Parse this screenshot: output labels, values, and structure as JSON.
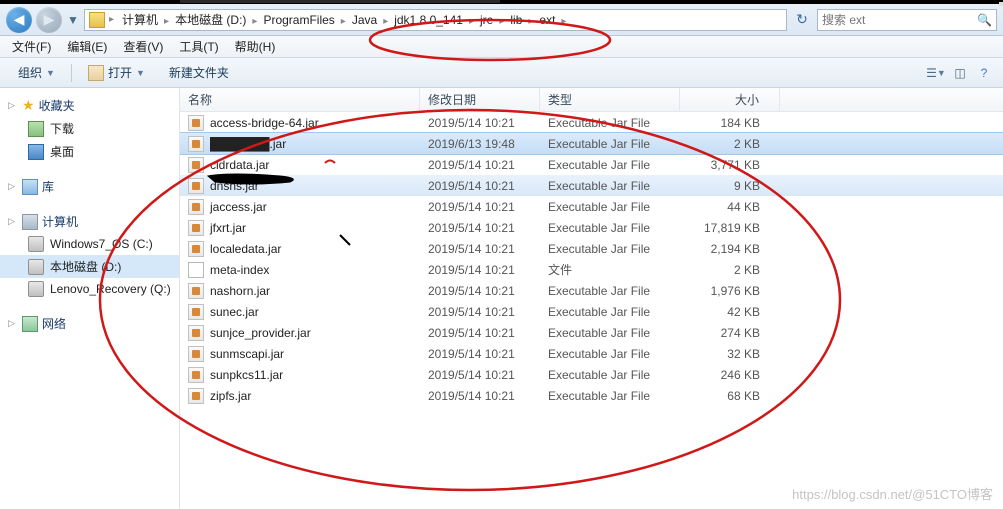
{
  "breadcrumb": {
    "items": [
      "计算机",
      "本地磁盘 (D:)",
      "ProgramFiles",
      "Java",
      "jdk1.8.0_141",
      "jre",
      "lib",
      "ext"
    ]
  },
  "search": {
    "placeholder": "搜索 ext"
  },
  "menubar": [
    "文件(F)",
    "编辑(E)",
    "查看(V)",
    "工具(T)",
    "帮助(H)"
  ],
  "toolbar": {
    "organize": "组织",
    "open": "打开",
    "newfolder": "新建文件夹"
  },
  "sidebar": {
    "favorites": {
      "label": "收藏夹",
      "items": [
        {
          "label": "下载",
          "icon": "dl-icon"
        },
        {
          "label": "桌面",
          "icon": "desk-icon"
        }
      ]
    },
    "libraries": {
      "label": "库"
    },
    "computer": {
      "label": "计算机",
      "items": [
        {
          "label": "Windows7_OS (C:)",
          "icon": "drive-icon"
        },
        {
          "label": "本地磁盘 (D:)",
          "icon": "drive-icon",
          "selected": true
        },
        {
          "label": "Lenovo_Recovery (Q:)",
          "icon": "drive-icon"
        }
      ]
    },
    "network": {
      "label": "网络"
    }
  },
  "columns": {
    "name": "名称",
    "date": "修改日期",
    "type": "类型",
    "size": "大小"
  },
  "files": [
    {
      "name": "access-bridge-64.jar",
      "date": "2019/5/14 10:21",
      "type": "Executable Jar File",
      "size": "184 KB",
      "icon": "jar-fi"
    },
    {
      "name": "███████.jar",
      "date": "2019/6/13 19:48",
      "type": "Executable Jar File",
      "size": "2 KB",
      "icon": "jar-fi",
      "selected": true
    },
    {
      "name": "cldrdata.jar",
      "date": "2019/5/14 10:21",
      "type": "Executable Jar File",
      "size": "3,771 KB",
      "icon": "jar-fi"
    },
    {
      "name": "dnsns.jar",
      "date": "2019/5/14 10:21",
      "type": "Executable Jar File",
      "size": "9 KB",
      "icon": "jar-fi",
      "hover": true
    },
    {
      "name": "jaccess.jar",
      "date": "2019/5/14 10:21",
      "type": "Executable Jar File",
      "size": "44 KB",
      "icon": "jar-fi"
    },
    {
      "name": "jfxrt.jar",
      "date": "2019/5/14 10:21",
      "type": "Executable Jar File",
      "size": "17,819 KB",
      "icon": "jar-fi"
    },
    {
      "name": "localedata.jar",
      "date": "2019/5/14 10:21",
      "type": "Executable Jar File",
      "size": "2,194 KB",
      "icon": "jar-fi"
    },
    {
      "name": "meta-index",
      "date": "2019/5/14 10:21",
      "type": "文件",
      "size": "2 KB",
      "icon": "txt-fi"
    },
    {
      "name": "nashorn.jar",
      "date": "2019/5/14 10:21",
      "type": "Executable Jar File",
      "size": "1,976 KB",
      "icon": "jar-fi"
    },
    {
      "name": "sunec.jar",
      "date": "2019/5/14 10:21",
      "type": "Executable Jar File",
      "size": "42 KB",
      "icon": "jar-fi"
    },
    {
      "name": "sunjce_provider.jar",
      "date": "2019/5/14 10:21",
      "type": "Executable Jar File",
      "size": "274 KB",
      "icon": "jar-fi"
    },
    {
      "name": "sunmscapi.jar",
      "date": "2019/5/14 10:21",
      "type": "Executable Jar File",
      "size": "32 KB",
      "icon": "jar-fi"
    },
    {
      "name": "sunpkcs11.jar",
      "date": "2019/5/14 10:21",
      "type": "Executable Jar File",
      "size": "246 KB",
      "icon": "jar-fi"
    },
    {
      "name": "zipfs.jar",
      "date": "2019/5/14 10:21",
      "type": "Executable Jar File",
      "size": "68 KB",
      "icon": "jar-fi"
    }
  ],
  "watermark": "https://blog.csdn.net/@51CTO博客"
}
